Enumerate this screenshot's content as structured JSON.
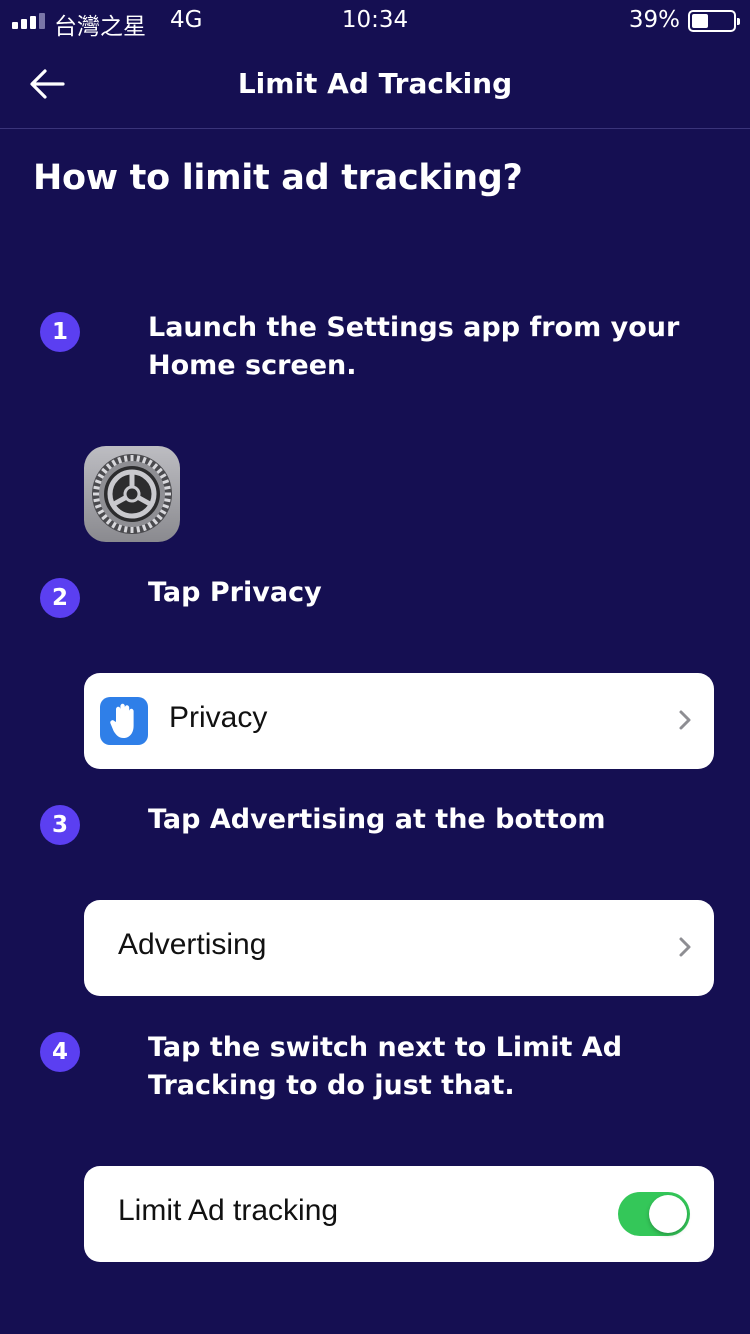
{
  "status_bar": {
    "carrier": "台灣之星",
    "network": "4G",
    "time": "10:34",
    "battery_percent": "39%",
    "battery_level": 0.39
  },
  "nav": {
    "title": "Limit Ad Tracking",
    "back_icon": "arrow-left-icon"
  },
  "heading": "How to limit ad tracking?",
  "steps": [
    {
      "number": "1",
      "text": "Launch the Settings app from your Home screen."
    },
    {
      "number": "2",
      "text": "Tap Privacy"
    },
    {
      "number": "3",
      "text": "Tap Advertising at the bottom"
    },
    {
      "number": "4",
      "text": "Tap the switch next to Limit Ad Tracking to do just that."
    }
  ],
  "cards": {
    "privacy": {
      "label": "Privacy",
      "icon": "hand-icon"
    },
    "advertising": {
      "label": "Advertising"
    },
    "limit_ad_tracking": {
      "label": "Limit Ad tracking",
      "toggle_on": true
    }
  },
  "colors": {
    "background": "#150f52",
    "step_badge": "#5b3ff1",
    "toggle_on": "#34c759",
    "privacy_icon_bg": "#2f7fe8"
  }
}
